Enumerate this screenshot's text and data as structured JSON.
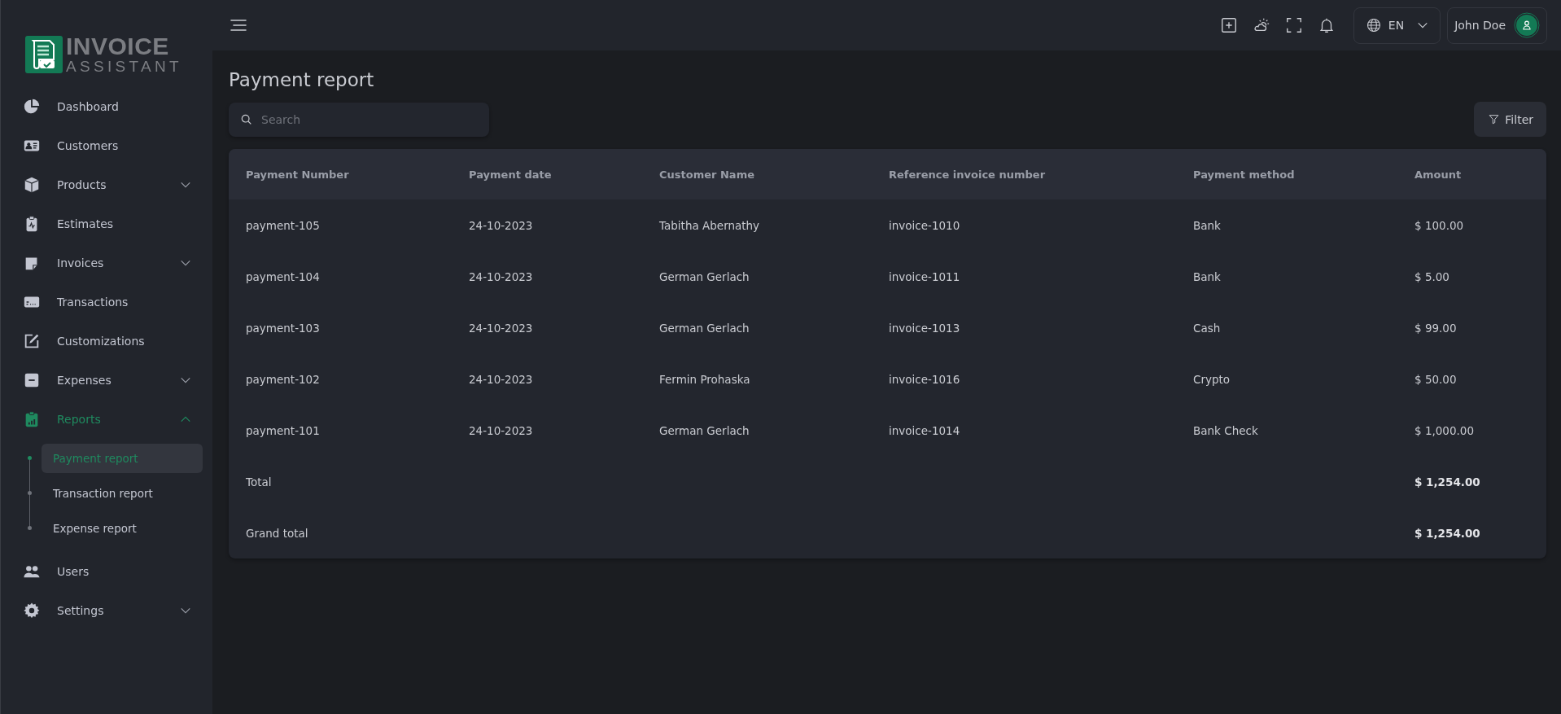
{
  "logo": {
    "line_1": "INVOICE",
    "line_2": "ASSISTANT"
  },
  "sidebar": {
    "items": [
      {
        "label": "Dashboard",
        "selected": false
      },
      {
        "label": "Customers",
        "selected": false
      },
      {
        "label": "Products",
        "selected": false,
        "expanded": false
      },
      {
        "label": "Estimates",
        "selected": false
      },
      {
        "label": "Invoices",
        "selected": false,
        "expanded": false
      },
      {
        "label": "Transactions",
        "selected": false
      },
      {
        "label": "Customizations",
        "selected": false
      },
      {
        "label": "Expenses",
        "selected": false,
        "expanded": false
      },
      {
        "label": "Reports",
        "selected": true,
        "expanded": true,
        "children": [
          {
            "label": "Payment report",
            "selected": true
          },
          {
            "label": "Transaction report",
            "selected": false
          },
          {
            "label": "Expense report",
            "selected": false
          }
        ]
      },
      {
        "label": "Users",
        "selected": false
      },
      {
        "label": "Settings",
        "selected": false,
        "expanded": false
      }
    ]
  },
  "top_bar": {
    "language": "EN",
    "user": "John Doe"
  },
  "page_title": "Payment report",
  "search": {
    "placeholder": "Search"
  },
  "filter_button": "Filter",
  "table": {
    "columns": [
      "Payment Number",
      "Payment date",
      "Customer Name",
      "Reference invoice number",
      "Payment method",
      "Amount"
    ],
    "rows": [
      [
        "payment-105",
        "24-10-2023",
        "Tabitha Abernathy",
        "invoice-1010",
        "Bank",
        "$ 100.00"
      ],
      [
        "payment-104",
        "24-10-2023",
        "German Gerlach",
        "invoice-1011",
        "Bank",
        "$ 5.00"
      ],
      [
        "payment-103",
        "24-10-2023",
        "German Gerlach",
        "invoice-1013",
        "Cash",
        "$ 99.00"
      ],
      [
        "payment-102",
        "24-10-2023",
        "Fermin Prohaska",
        "invoice-1016",
        "Crypto",
        "$ 50.00"
      ],
      [
        "payment-101",
        "24-10-2023",
        "German Gerlach",
        "invoice-1014",
        "Bank Check",
        "$ 1,000.00"
      ]
    ],
    "totals": [
      {
        "label": "Total",
        "amount": "$ 1,254.00"
      },
      {
        "label": "Grand total",
        "amount": "$ 1,254.00"
      }
    ]
  }
}
